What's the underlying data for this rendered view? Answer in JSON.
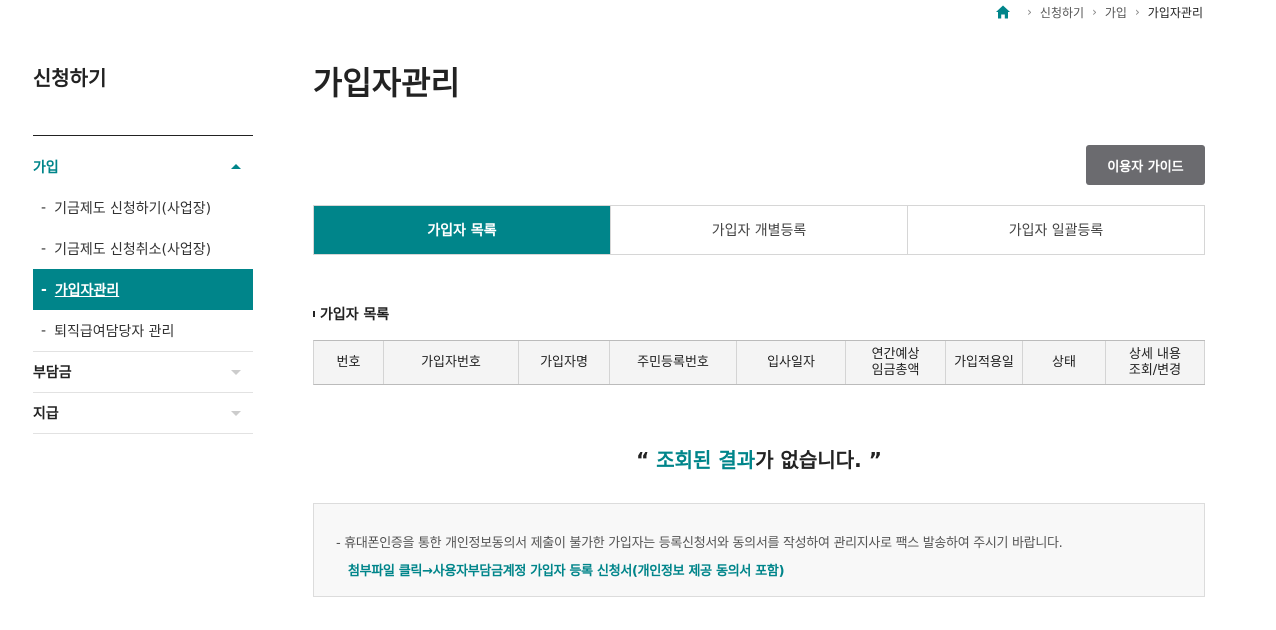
{
  "breadcrumb": {
    "home_icon": "home-icon",
    "items": [
      "신청하기",
      "가입",
      "가입자관리"
    ]
  },
  "sidebar": {
    "title": "신청하기",
    "groups": [
      {
        "label": "가입",
        "state": "expanded",
        "items": [
          {
            "label": "기금제도 신청하기(사업장)"
          },
          {
            "label": "기금제도 신청취소(사업장)"
          },
          {
            "label": "가입자관리",
            "active": true
          },
          {
            "label": "퇴직급여담당자 관리"
          }
        ]
      },
      {
        "label": "부담금",
        "state": "collapsed"
      },
      {
        "label": "지급",
        "state": "collapsed"
      }
    ]
  },
  "page": {
    "title": "가입자관리",
    "guide_button": "이용자 가이드"
  },
  "tabs": [
    {
      "label": "가입자 목록",
      "active": true
    },
    {
      "label": "가입자 개별등록",
      "active": false
    },
    {
      "label": "가입자 일괄등록",
      "active": false
    }
  ],
  "section_title": "가입자 목록",
  "table": {
    "columns": [
      "번호",
      "가입자번호",
      "가입자명",
      "주민등록번호",
      "입사일자",
      "연간예상\n임금총액",
      "가입적용일",
      "상태",
      "상세 내용\n조회/변경"
    ]
  },
  "empty": {
    "open_quote": "“ ",
    "highlight": "조회된 결과",
    "rest": "가 없습니다. ",
    "close_quote": "”"
  },
  "notice": {
    "line1": "- 휴대폰인증을 통한 개인정보동의서 제출이 불가한 가입자는 등록신청서와 동의서를 작성하여 관리지사로 팩스 발송하여 주시기 바랍니다.",
    "link": "첨부파일 클릭→사용자부담금계정 가입자 등록 신청서(개인정보 제공 동의서 포함)"
  },
  "colors": {
    "accent": "#00858a",
    "guide_button": "#6b6b6f"
  }
}
